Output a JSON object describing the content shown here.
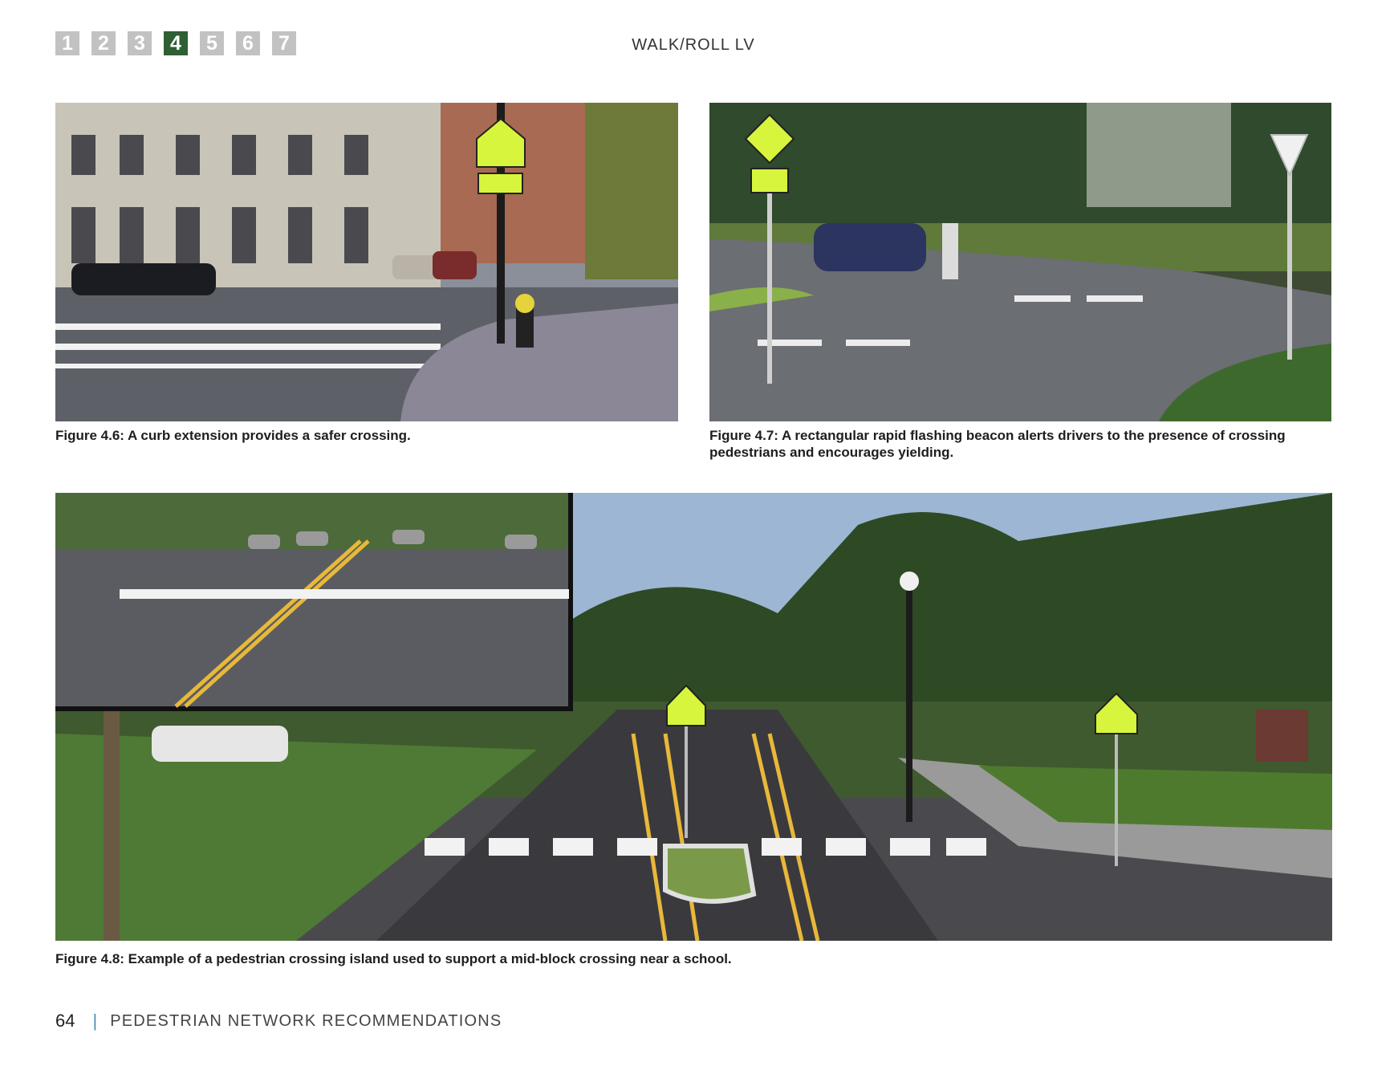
{
  "header": {
    "chapter_tabs": [
      "1",
      "2",
      "3",
      "4",
      "5",
      "6",
      "7"
    ],
    "active_chapter": "4",
    "document_title": "WALK/ROLL LV"
  },
  "figures": [
    {
      "id": "4.6",
      "caption": "Figure 4.6: A curb extension provides a safer crossing."
    },
    {
      "id": "4.7",
      "caption": "Figure 4.7: A rectangular rapid flashing beacon alerts drivers to the presence of crossing pedestrians and encourages yielding."
    },
    {
      "id": "4.8",
      "caption": "Figure 4.8: Example of a pedestrian crossing island used to support a mid-block crossing near a school."
    }
  ],
  "footer": {
    "page_number": "64",
    "separator": "|",
    "section_title": "PEDESTRIAN NETWORK RECOMMENDATIONS"
  },
  "colors": {
    "active_tab": "#2f5f34",
    "inactive_tab": "#c2c2c2",
    "footer_separator": "#4a90b8"
  }
}
